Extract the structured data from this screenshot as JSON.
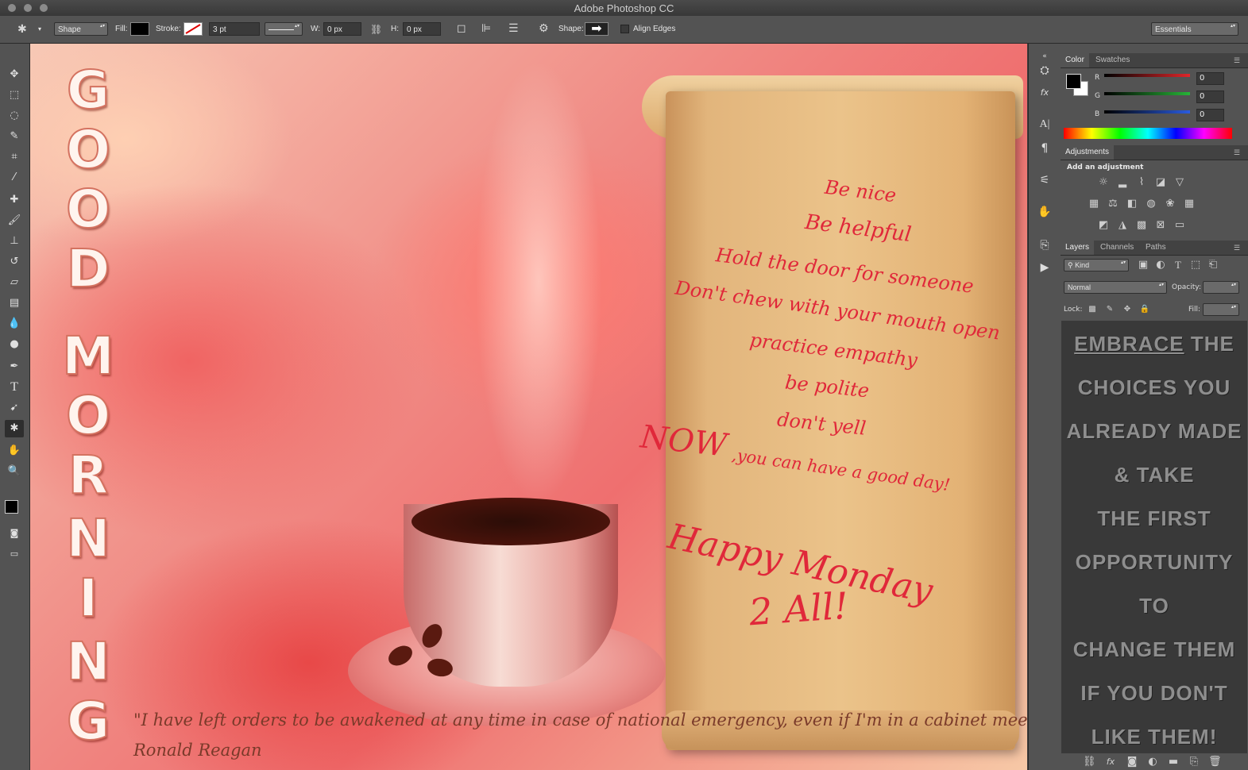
{
  "app": {
    "title": "Adobe Photoshop CC"
  },
  "options_bar": {
    "mode": "Shape",
    "fill_label": "Fill:",
    "stroke_label": "Stroke:",
    "stroke_width": "3 pt",
    "w_label": "W:",
    "w_value": "0 px",
    "h_label": "H:",
    "h_value": "0 px",
    "shape_label": "Shape:",
    "align_edges_label": "Align Edges",
    "workspace": "Essentials"
  },
  "color_panel": {
    "tabs": [
      "Color",
      "Swatches"
    ],
    "channels": [
      {
        "label": "R",
        "value": "0",
        "color": "#e0262a"
      },
      {
        "label": "G",
        "value": "0",
        "color": "#27b437"
      },
      {
        "label": "B",
        "value": "0",
        "color": "#2a5ce0"
      }
    ]
  },
  "adjustments_panel": {
    "tab": "Adjustments",
    "heading": "Add an adjustment"
  },
  "layers_panel": {
    "tabs": [
      "Layers",
      "Channels",
      "Paths"
    ],
    "kind_label": "Kind",
    "blend_mode": "Normal",
    "opacity_label": "Opacity:",
    "lock_label": "Lock:",
    "fill_label": "Fill:"
  },
  "layers_preview_text": {
    "line1a": "EMBRACE",
    "line1b": " THE",
    "line2": "CHOICES YOU",
    "line3": "ALREADY MADE",
    "line4": "& TAKE",
    "line5": "THE FIRST",
    "line6": "OPPORTUNITY",
    "line7": "TO",
    "line8": "CHANGE THEM",
    "line9": "IF YOU DON'T",
    "line10": "LIKE THEM!"
  },
  "canvas": {
    "vertical_text": [
      "G",
      "O",
      "O",
      "D",
      "M",
      "O",
      "R",
      "N",
      "I",
      "N",
      "G"
    ],
    "scroll_lines": {
      "l1": "Be nice",
      "l2": "Be helpful",
      "l3": "Hold the door for someone",
      "l4": "Don't chew with your mouth open",
      "l5": "practice empathy",
      "l6": "be polite",
      "l7": "don't yell",
      "now": "NOW",
      "l8": ",you can have a good day!",
      "happy": "Happy Monday",
      "all": "2 All!"
    },
    "quote": "\"I have left orders to be awakened at any time in case of national emergency, even if I'm in a cabinet meeting\".",
    "author": "Ronald Reagan"
  }
}
